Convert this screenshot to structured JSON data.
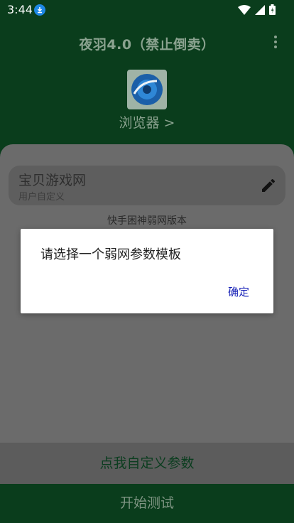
{
  "status_bar": {
    "time": "3:44"
  },
  "header": {
    "title": "夜羽4.0（禁止倒卖）"
  },
  "browser": {
    "label": "浏览器 >"
  },
  "template_field": {
    "name": "宝贝游戏网",
    "subtitle": "用户自定义"
  },
  "version_label": "快手困神弱网版本",
  "buttons": {
    "custom_params": "点我自定义参数",
    "start_test": "开始测试"
  },
  "dialog": {
    "message": "请选择一个弱网参数模板",
    "confirm": "确定"
  },
  "colors": {
    "dark_green": "#0a3d1c",
    "dialog_accent": "#1a24b8",
    "overlay_gray": "#6b6b6b"
  }
}
